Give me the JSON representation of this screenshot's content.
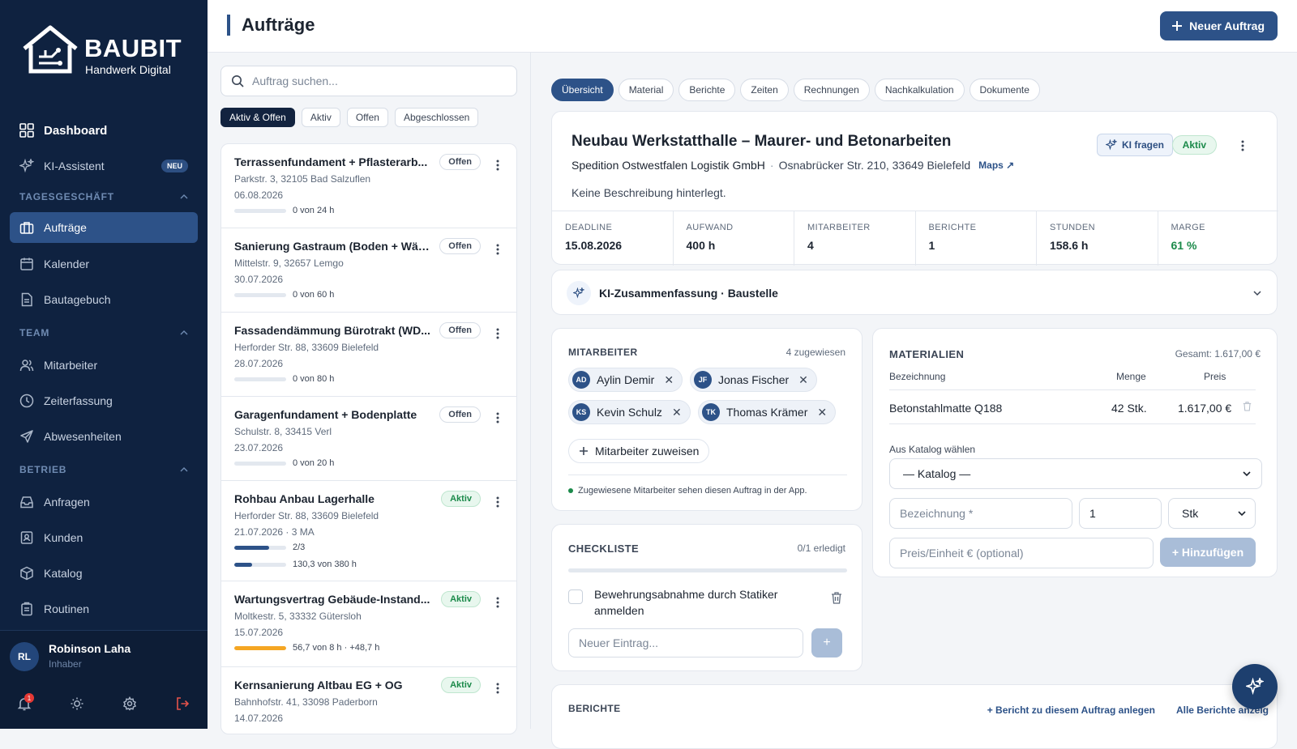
{
  "sidebar": {
    "brand": "BAUBIT",
    "tagline": "Handwerk Digital",
    "dashboard": "Dashboard",
    "ki": "KI-Assistent",
    "ki_badge": "NEU",
    "sections": {
      "tages": "TAGESGESCHÄFT",
      "team": "TEAM",
      "betrieb": "BETRIEB"
    },
    "items": {
      "auftraege": "Aufträge",
      "kalender": "Kalender",
      "bautagebuch": "Bautagebuch",
      "mitarbeiter": "Mitarbeiter",
      "zeiterfassung": "Zeiterfassung",
      "abwesenheiten": "Abwesenheiten",
      "anfragen": "Anfragen",
      "kunden": "Kunden",
      "katalog": "Katalog",
      "routinen": "Routinen"
    },
    "user": {
      "initials": "RL",
      "name": "Robinson Laha",
      "role": "Inhaber",
      "notifications": "1"
    }
  },
  "header": {
    "title": "Aufträge",
    "new_button": "Neuer Auftrag"
  },
  "list": {
    "search_placeholder": "Auftrag suchen...",
    "filters": [
      "Aktiv & Offen",
      "Aktiv",
      "Offen",
      "Abgeschlossen"
    ],
    "orders": [
      {
        "title": "Terrassenfundament + Pflasterarb...",
        "address": "Parkstr. 3, 32105 Bad Salzuflen",
        "date": "06.08.2026",
        "status": "Offen",
        "progress_text": "0 von 24 h",
        "progress": 0
      },
      {
        "title": "Sanierung Gastraum (Boden + Wän...",
        "address": "Mittelstr. 9, 32657 Lemgo",
        "date": "30.07.2026",
        "status": "Offen",
        "progress_text": "0 von 60 h",
        "progress": 0
      },
      {
        "title": "Fassadendämmung Bürotrakt (WD...",
        "address": "Herforder Str. 88, 33609 Bielefeld",
        "date": "28.07.2026",
        "status": "Offen",
        "progress_text": "0 von 80 h",
        "progress": 0
      },
      {
        "title": "Garagenfundament + Bodenplatte",
        "address": "Schulstr. 8, 33415 Verl",
        "date": "23.07.2026",
        "status": "Offen",
        "progress_text": "0 von 20 h",
        "progress": 0
      },
      {
        "title": "Rohbau Anbau Lagerhalle",
        "address": "Herforder Str. 88, 33609 Bielefeld",
        "date": "21.07.2026 · 3 MA",
        "status": "Aktiv",
        "tasks_text": "2/3",
        "tasks_progress": 0.67,
        "progress_text": "130,3 von 380 h",
        "progress": 0.34
      },
      {
        "title": "Wartungsvertrag Gebäude-Instand...",
        "address": "Moltkestr. 5, 33332 Gütersloh",
        "date": "15.07.2026",
        "status": "Aktiv",
        "progress_text": "56,7 von 8 h · +48,7 h",
        "progress": 1.0
      },
      {
        "title": "Kernsanierung Altbau EG + OG",
        "address": "Bahnhofstr. 41, 33098 Paderborn",
        "date": "14.07.2026",
        "status": "Aktiv"
      }
    ]
  },
  "detail": {
    "tabs": [
      "Übersicht",
      "Material",
      "Berichte",
      "Zeiten",
      "Rechnungen",
      "Nachkalkulation",
      "Dokumente"
    ],
    "title": "Neubau Werkstatthalle – Maurer- und Betonarbeiten",
    "customer": "Spedition Ostwestfalen Logistik GmbH",
    "separator": "·",
    "address": "Osnabrücker Str. 210, 33649 Bielefeld",
    "maps": "Maps ↗",
    "description": "Keine Beschreibung hinterlegt.",
    "ki_button": "KI fragen",
    "status": "Aktiv",
    "kpis": [
      {
        "label": "DEADLINE",
        "value": "15.08.2026"
      },
      {
        "label": "AUFWAND",
        "value": "400 h"
      },
      {
        "label": "MITARBEITER",
        "value": "4"
      },
      {
        "label": "BERICHTE",
        "value": "1"
      },
      {
        "label": "STUNDEN",
        "value": "158.6 h"
      },
      {
        "label": "MARGE",
        "value": "61 %"
      }
    ],
    "ki_summary": "KI-Zusammenfassung · Baustelle",
    "employees": {
      "title": "MITARBEITER",
      "count": "4 zugewiesen",
      "people": [
        {
          "initials": "AD",
          "name": "Aylin Demir"
        },
        {
          "initials": "JF",
          "name": "Jonas Fischer"
        },
        {
          "initials": "KS",
          "name": "Kevin Schulz"
        },
        {
          "initials": "TK",
          "name": "Thomas Krämer"
        }
      ],
      "assign": "Mitarbeiter zuweisen",
      "note": "Zugewiesene Mitarbeiter sehen diesen Auftrag in der App."
    },
    "checklist": {
      "title": "CHECKLISTE",
      "count": "0/1 erledigt",
      "items": [
        "Bewehrungsabnahme durch Statiker anmelden"
      ],
      "placeholder": "Neuer Eintrag...",
      "add": "+"
    },
    "materials": {
      "title": "MATERIALIEN",
      "total": "Gesamt: 1.617,00 €",
      "headers": {
        "name": "Bezeichnung",
        "qty": "Menge",
        "price": "Preis"
      },
      "rows": [
        {
          "name": "Betonstahlmatte Q188",
          "qty": "42 Stk.",
          "price": "1.617,00 €"
        }
      ],
      "catalog_label": "Aus Katalog wählen",
      "catalog_value": "— Katalog —",
      "name_placeholder": "Bezeichnung *",
      "qty_value": "1",
      "unit_value": "Stk",
      "price_placeholder": "Preis/Einheit € (optional)",
      "add_button": "+ Hinzufügen"
    },
    "reports": {
      "title": "BERICHTE",
      "create": "+ Bericht zu diesem Auftrag anlegen",
      "all": "Alle Berichte anzeig"
    }
  },
  "colors": {
    "sidebar": "#0f2240",
    "accent": "#2d5288",
    "success": "#1b8a4a",
    "warning": "#f5a623"
  }
}
